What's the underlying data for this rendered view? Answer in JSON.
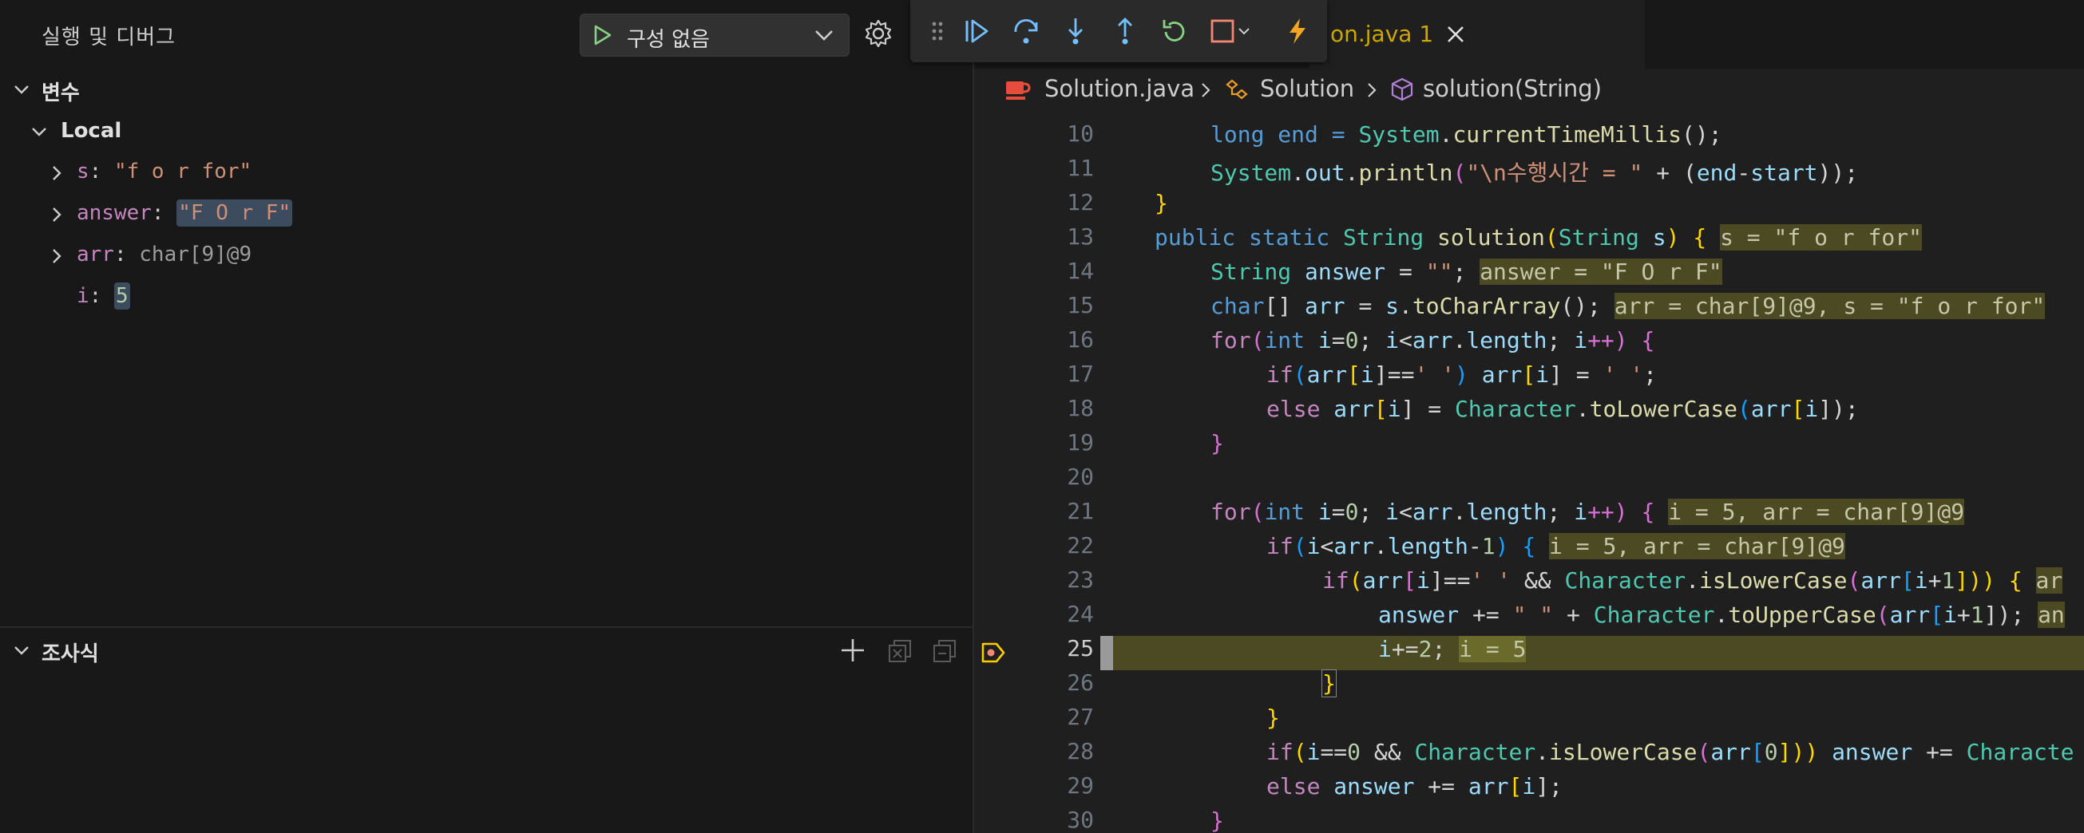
{
  "panel": {
    "title": "실행 및 디버그",
    "run_config": "구성 없음"
  },
  "variables": {
    "section_label": "변수",
    "scope_label": "Local",
    "items": [
      {
        "name": "s",
        "value": "\"f o r for\""
      },
      {
        "name": "answer",
        "value": "\"F O r F\""
      },
      {
        "name": "arr",
        "value": "char[9]@9"
      },
      {
        "name": "i",
        "value": "5"
      }
    ]
  },
  "watch": {
    "section_label": "조사식"
  },
  "tab": {
    "label": "on.java 1"
  },
  "breadcrumb": {
    "file": "Solution.java",
    "class": "Solution",
    "method": "solution(String)"
  },
  "editor": {
    "line_numbers": [
      "10",
      "11",
      "12",
      "13",
      "14",
      "15",
      "16",
      "17",
      "18",
      "19",
      "20",
      "21",
      "22",
      "23",
      "24",
      "25",
      "26",
      "27",
      "28",
      "29",
      "30"
    ],
    "current_line": "25"
  },
  "code": {
    "l10": {
      "a": "long end = ",
      "b": "System",
      "c": ".",
      "d": "currentTimeMillis",
      "e": "();"
    },
    "l11": {
      "a": "System",
      "b": ".",
      "c": "out",
      "d": ".",
      "e": "println",
      "f": "(",
      "g": "\"\\n수행시간 = \"",
      "h": " + (",
      "i": "end",
      "j": "-",
      "k": "start",
      "l": "));"
    },
    "l12": {
      "a": "}"
    },
    "l13": {
      "a": "public static ",
      "b": "String ",
      "c": "solution",
      "d": "(",
      "e": "String ",
      "f": "s",
      "g": ") {",
      "iv": "s = \"f o r for\""
    },
    "l14": {
      "a": "String ",
      "b": "answer",
      "c": " = ",
      "d": "\"\"",
      "e": ";",
      "iv": "answer = \"F O r F\""
    },
    "l15": {
      "a": "char",
      "b": "[] ",
      "c": "arr",
      "d": " = ",
      "e": "s",
      "f": ".",
      "g": "toCharArray",
      "h": "();",
      "iv": "arr = char[9]@9, s = \"f o r for\""
    },
    "l16": {
      "a": "for",
      "b": "(",
      "c": "int ",
      "d": "i",
      "e": "=",
      "f": "0",
      "g": "; ",
      "h": "i",
      "i": "<",
      "j": "arr",
      "k": ".",
      "l": "length",
      "m": "; ",
      "n": "i",
      "o": "++) {"
    },
    "l17": {
      "a": "if",
      "b": "(",
      "c": "arr",
      "d": "[",
      "e": "i",
      "f": "]==",
      "g": "' '",
      "h": ") ",
      "i": "arr",
      "j": "[",
      "k": "i",
      "l": "] = ",
      "m": "' '",
      "n": ";"
    },
    "l18": {
      "a": "else ",
      "b": "arr",
      "c": "[",
      "d": "i",
      "e": "] = ",
      "f": "Character",
      "g": ".",
      "h": "toLowerCase",
      "i": "(",
      "j": "arr",
      "k": "[",
      "l": "i",
      "m": "]);"
    },
    "l19": {
      "a": "}"
    },
    "l21": {
      "a": "for",
      "b": "(",
      "c": "int ",
      "d": "i",
      "e": "=",
      "f": "0",
      "g": "; ",
      "h": "i",
      "i": "<",
      "j": "arr",
      "k": ".",
      "l": "length",
      "m": "; ",
      "n": "i",
      "o": "++) {",
      "iv": "i = 5, arr = char[9]@9"
    },
    "l22": {
      "a": "if",
      "b": "(",
      "c": "i",
      "d": "<",
      "e": "arr",
      "f": ".",
      "g": "length",
      "h": "-",
      "i": "1",
      "j": ") {",
      "iv": "i = 5, arr = char[9]@9"
    },
    "l23": {
      "a": "if",
      "b": "(",
      "c": "arr",
      "d": "[",
      "e": "i",
      "f": "]==",
      "g": "' '",
      "h": " && ",
      "i": "Character",
      "j": ".",
      "k": "isLowerCase",
      "l": "(",
      "m": "arr",
      "n": "[",
      "o": "i",
      "p": "+",
      "q": "1",
      "r": "])) {",
      "iv": "ar"
    },
    "l24": {
      "a": "answer",
      "b": " += ",
      "c": "\" \"",
      "d": " + ",
      "e": "Character",
      "f": ".",
      "g": "toUpperCase",
      "h": "(",
      "i": "arr",
      "j": "[",
      "k": "i",
      "l": "+",
      "m": "1",
      "n": "]);",
      "iv": "an"
    },
    "l25": {
      "a": "i",
      "b": "+=",
      "c": "2",
      "d": ";",
      "iv": "i = 5"
    },
    "l26": {
      "a": "}"
    },
    "l27": {
      "a": "}"
    },
    "l28": {
      "a": "if",
      "b": "(",
      "c": "i",
      "d": "==",
      "e": "0",
      "f": " && ",
      "g": "Character",
      "h": ".",
      "i": "isLowerCase",
      "j": "(",
      "k": "arr",
      "l": "[",
      "m": "0",
      "n": "])) ",
      "o": "answer",
      "p": " += ",
      "q": "Characte"
    },
    "l29": {
      "a": "else ",
      "b": "answer",
      "c": " += ",
      "d": "arr",
      "e": "[",
      "f": "i",
      "g": "];"
    },
    "l30": {
      "a": "}"
    }
  },
  "colors": {
    "accent": "#cca700",
    "current_line": "#4b4a22",
    "debug_blue": "#75beff",
    "debug_green": "#89d185",
    "debug_red": "#f48771"
  }
}
